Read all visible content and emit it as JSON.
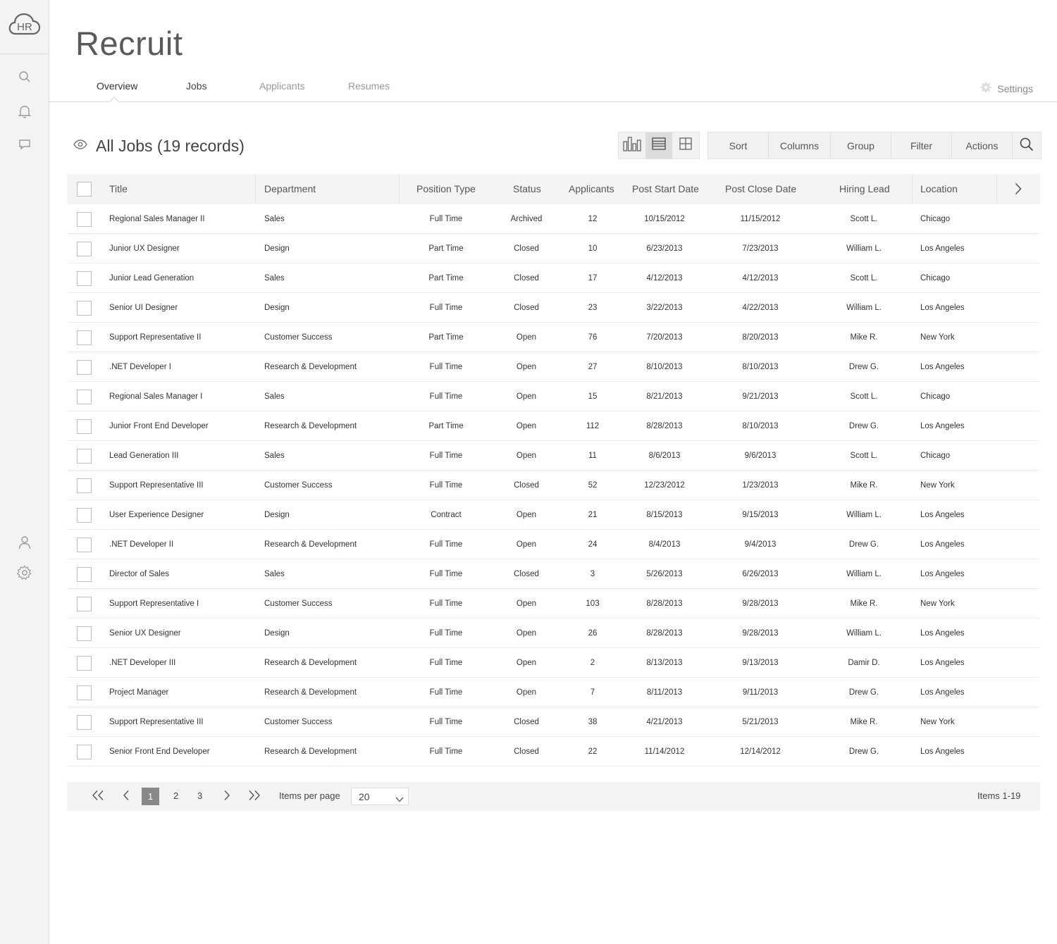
{
  "app": {
    "logo_text": "HR",
    "title": "Recruit"
  },
  "tabs": [
    {
      "label": "Overview"
    },
    {
      "label": "Jobs"
    },
    {
      "label": "Applicants"
    },
    {
      "label": "Resumes"
    }
  ],
  "settings_label": "Settings",
  "list": {
    "title": "All Jobs (19 records)"
  },
  "toolbar": {
    "sort": "Sort",
    "columns": "Columns",
    "group": "Group",
    "filter": "Filter",
    "actions": "Actions"
  },
  "columns": {
    "title": "Title",
    "department": "Department",
    "position_type": "Position Type",
    "status": "Status",
    "applicants": "Applicants",
    "post_start": "Post Start Date",
    "post_close": "Post Close Date",
    "hiring_lead": "Hiring Lead",
    "location": "Location"
  },
  "rows": [
    [
      "Regional Sales Manager II",
      "Sales",
      "Full Time",
      "Archived",
      "12",
      "10/15/2012",
      "11/15/2012",
      "Scott L.",
      "Chicago"
    ],
    [
      "Junior UX Designer",
      "Design",
      "Part Time",
      "Closed",
      "10",
      "6/23/2013",
      "7/23/2013",
      "William L.",
      "Los Angeles"
    ],
    [
      "Junior Lead Generation",
      "Sales",
      "Part Time",
      "Closed",
      "17",
      "4/12/2013",
      "4/12/2013",
      "Scott L.",
      "Chicago"
    ],
    [
      "Senior UI Designer",
      "Design",
      "Full Time",
      "Closed",
      "23",
      "3/22/2013",
      "4/22/2013",
      "William L.",
      "Los Angeles"
    ],
    [
      "Support Representative II",
      "Customer Success",
      "Part Time",
      "Open",
      "76",
      "7/20/2013",
      "8/20/2013",
      "Mike R.",
      "New York"
    ],
    [
      ".NET Developer I",
      "Research & Development",
      "Full Time",
      "Open",
      "27",
      "8/10/2013",
      "8/10/2013",
      "Drew G.",
      "Los Angeles"
    ],
    [
      "Regional Sales Manager I",
      "Sales",
      "Full Time",
      "Open",
      "15",
      "8/21/2013",
      "9/21/2013",
      "Scott L.",
      "Chicago"
    ],
    [
      "Junior Front End Developer",
      "Research & Development",
      "Part Time",
      "Open",
      "112",
      "8/28/2013",
      "8/10/2013",
      "Drew G.",
      "Los Angeles"
    ],
    [
      "Lead Generation III",
      "Sales",
      "Full Time",
      "Open",
      "11",
      "8/6/2013",
      "9/6/2013",
      "Scott L.",
      "Chicago"
    ],
    [
      "Support Representative III",
      "Customer Success",
      "Full Time",
      "Closed",
      "52",
      "12/23/2012",
      "1/23/2013",
      "Mike R.",
      "New York"
    ],
    [
      "User Experience Designer",
      "Design",
      "Contract",
      "Open",
      "21",
      "8/15/2013",
      "9/15/2013",
      "William L.",
      "Los Angeles"
    ],
    [
      ".NET Developer II",
      "Research & Development",
      "Full Time",
      "Open",
      "24",
      "8/4/2013",
      "9/4/2013",
      "Drew G.",
      "Los Angeles"
    ],
    [
      "Director of Sales",
      "Sales",
      "Full Time",
      "Closed",
      "3",
      "5/26/2013",
      "6/26/2013",
      "William L.",
      "Los Angeles"
    ],
    [
      "Support Representative I",
      "Customer Success",
      "Full Time",
      "Open",
      "103",
      "8/28/2013",
      "9/28/2013",
      "Mike R.",
      "New York"
    ],
    [
      "Senior UX Designer",
      "Design",
      "Full Time",
      "Open",
      "26",
      "8/28/2013",
      "9/28/2013",
      "William L.",
      "Los Angeles"
    ],
    [
      ".NET Developer III",
      "Research & Development",
      "Full Time",
      "Open",
      "2",
      "8/13/2013",
      "9/13/2013",
      "Damir D.",
      "Los Angeles"
    ],
    [
      "Project Manager",
      "Research & Development",
      "Full Time",
      "Open",
      "7",
      "8/11/2013",
      "9/11/2013",
      "Drew G.",
      "Los Angeles"
    ],
    [
      "Support Representative III",
      "Customer Success",
      "Full Time",
      "Closed",
      "38",
      "4/21/2013",
      "5/21/2013",
      "Mike R.",
      "New York"
    ],
    [
      "Senior Front End Developer",
      "Research & Development",
      "Full Time",
      "Closed",
      "22",
      "11/14/2012",
      "12/14/2012",
      "Drew G.",
      "Los Angeles"
    ]
  ],
  "pager": {
    "pages": [
      "1",
      "2",
      "3"
    ],
    "items_per_page_label": "Items per page",
    "items_per_page": "20",
    "items_range": "Items 1-19"
  }
}
